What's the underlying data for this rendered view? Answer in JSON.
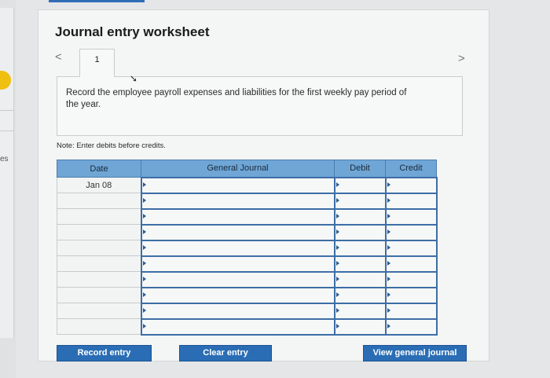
{
  "sidebar": {
    "partial_text": "es"
  },
  "worksheet": {
    "title": "Journal entry worksheet",
    "prev_glyph": "<",
    "next_glyph": ">",
    "tab_label": "1",
    "instruction": "Record the employee payroll expenses and liabilities for the first weekly pay period of the year.",
    "note": "Note: Enter debits before credits."
  },
  "table": {
    "headers": {
      "date": "Date",
      "general_journal": "General Journal",
      "debit": "Debit",
      "credit": "Credit"
    },
    "rows": [
      {
        "date": "Jan 08",
        "account": "",
        "debit": "",
        "credit": ""
      },
      {
        "date": "",
        "account": "",
        "debit": "",
        "credit": ""
      },
      {
        "date": "",
        "account": "",
        "debit": "",
        "credit": ""
      },
      {
        "date": "",
        "account": "",
        "debit": "",
        "credit": ""
      },
      {
        "date": "",
        "account": "",
        "debit": "",
        "credit": ""
      },
      {
        "date": "",
        "account": "",
        "debit": "",
        "credit": ""
      },
      {
        "date": "",
        "account": "",
        "debit": "",
        "credit": ""
      },
      {
        "date": "",
        "account": "",
        "debit": "",
        "credit": ""
      },
      {
        "date": "",
        "account": "",
        "debit": "",
        "credit": ""
      },
      {
        "date": "",
        "account": "",
        "debit": "",
        "credit": ""
      }
    ]
  },
  "buttons": {
    "record": "Record entry",
    "clear": "Clear entry",
    "view": "View general journal"
  },
  "colors": {
    "accent": "#2a6db5",
    "header": "#6fa6d6",
    "highlight": "#f0c010"
  }
}
